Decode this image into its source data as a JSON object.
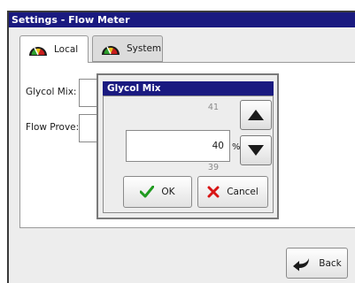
{
  "window": {
    "title": "Settings - Flow Meter"
  },
  "tabs": [
    {
      "label": "Local",
      "icon": "gauge-icon",
      "active": true
    },
    {
      "label": "System",
      "icon": "gauge-icon",
      "active": false
    }
  ],
  "fields": {
    "glycol_mix_label": "Glycol Mix:",
    "flow_prove_label": "Flow Prove:"
  },
  "dialog": {
    "title": "Glycol Mix",
    "prev_value": "41",
    "current_value": "40",
    "next_value": "39",
    "unit": "%",
    "ok_label": "OK",
    "cancel_label": "Cancel"
  },
  "footer": {
    "back_label": "Back"
  },
  "colors": {
    "title_bar": "#1a1a80",
    "ok_check": "#1f9a1f",
    "cancel_x": "#d81414",
    "gauge_green": "#2e9e2e",
    "gauge_red": "#c81e1e"
  }
}
